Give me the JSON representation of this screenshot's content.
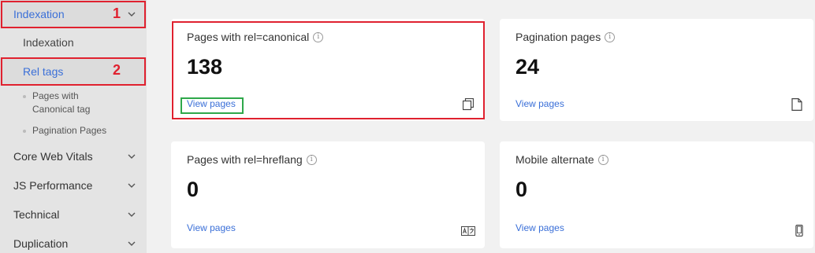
{
  "sidebar": {
    "indexation_group": "Indexation",
    "indexation_item": "Indexation",
    "rel_tags": "Rel tags",
    "leaf_canonical": "Pages with Canonical tag",
    "leaf_pagination": "Pagination Pages",
    "core_web_vitals": "Core Web Vitals",
    "js_performance": "JS Performance",
    "technical": "Technical",
    "duplication": "Duplication"
  },
  "annotations": {
    "num1": "1",
    "num2": "2",
    "red": "#e0212f",
    "green": "#2ea84a"
  },
  "cards": [
    {
      "title": "Pages with rel=canonical",
      "value": "138",
      "link": "View pages",
      "icon": "copy-icon"
    },
    {
      "title": "Pagination pages",
      "value": "24",
      "link": "View pages",
      "icon": "document-icon"
    },
    {
      "title": "Pages with rel=hreflang",
      "value": "0",
      "link": "View pages",
      "icon": "translate-icon"
    },
    {
      "title": "Mobile alternate",
      "value": "0",
      "link": "View pages",
      "icon": "mobile-icon"
    }
  ],
  "colors": {
    "accent": "#3a6fd8",
    "sidebar_bg": "#e4e4e4",
    "page_bg": "#f1f1f1"
  }
}
